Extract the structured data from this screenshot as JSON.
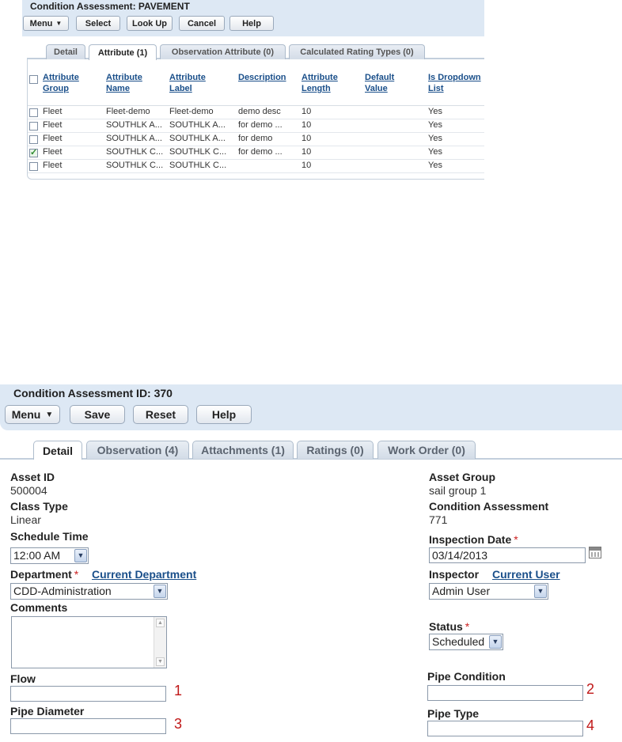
{
  "panel1": {
    "title": "Condition Assessment: PAVEMENT",
    "toolbar": {
      "menu": "Menu",
      "select": "Select",
      "lookup": "Look Up",
      "cancel": "Cancel",
      "help": "Help"
    },
    "tabs": [
      "Detail",
      "Attribute (1)",
      "Observation Attribute (0)",
      "Calculated Rating Types (0)"
    ],
    "active_tab": "Attribute (1)",
    "columns": {
      "group": [
        "Attribute",
        "Group"
      ],
      "name": [
        "Attribute",
        "Name"
      ],
      "label": [
        "Attribute",
        "Label"
      ],
      "description": [
        "Description",
        ""
      ],
      "length": [
        "Attribute",
        "Length"
      ],
      "default": [
        "Default",
        "Value"
      ],
      "dropdown": [
        "Is Dropdown",
        "List"
      ]
    },
    "rows": [
      {
        "checked": false,
        "group": "Fleet",
        "name": "Fleet-demo",
        "label": "Fleet-demo",
        "description": "demo desc",
        "length": "10",
        "default": "",
        "dropdown": "Yes"
      },
      {
        "checked": false,
        "group": "Fleet",
        "name": "SOUTHLK A...",
        "label": "SOUTHLK A...",
        "description": "for demo ...",
        "length": "10",
        "default": "",
        "dropdown": "Yes"
      },
      {
        "checked": false,
        "group": "Fleet",
        "name": "SOUTHLK A...",
        "label": "SOUTHLK A...",
        "description": "for demo",
        "length": "10",
        "default": "",
        "dropdown": "Yes"
      },
      {
        "checked": true,
        "group": "Fleet",
        "name": "SOUTHLK C...",
        "label": "SOUTHLK C...",
        "description": "for demo ...",
        "length": "10",
        "default": "",
        "dropdown": "Yes"
      },
      {
        "checked": false,
        "group": "Fleet",
        "name": "SOUTHLK C...",
        "label": "SOUTHLK C...",
        "description": "",
        "length": "10",
        "default": "",
        "dropdown": "Yes"
      }
    ]
  },
  "panel2": {
    "title": "Condition Assessment ID: 370",
    "toolbar": {
      "menu": "Menu",
      "save": "Save",
      "reset": "Reset",
      "help": "Help"
    },
    "tabs": [
      "Detail",
      "Observation (4)",
      "Attachments (1)",
      "Ratings (0)",
      "Work Order (0)"
    ],
    "active_tab": "Detail",
    "fields": {
      "asset_id": {
        "label": "Asset ID",
        "value": "500004"
      },
      "class_type": {
        "label": "Class Type",
        "value": "Linear"
      },
      "schedule_time": {
        "label": "Schedule Time",
        "value": "12:00 AM"
      },
      "department": {
        "label": "Department",
        "required": "*",
        "link": "Current Department",
        "value": "CDD-Administration"
      },
      "comments": {
        "label": "Comments",
        "value": ""
      },
      "flow": {
        "label": "Flow",
        "value": "",
        "marker": "1"
      },
      "pipe_diameter": {
        "label": "Pipe Diameter",
        "value": "",
        "marker": "3"
      },
      "asset_group": {
        "label": "Asset Group",
        "value": "sail group 1"
      },
      "condition_assessment": {
        "label": "Condition Assessment",
        "value": "771"
      },
      "inspection_date": {
        "label": "Inspection Date",
        "required": "*",
        "value": "03/14/2013"
      },
      "inspector": {
        "label": "Inspector",
        "link": "Current User",
        "value": "Admin User"
      },
      "status": {
        "label": "Status",
        "required": "*",
        "value": "Scheduled"
      },
      "pipe_condition": {
        "label": "Pipe Condition",
        "value": "",
        "marker": "2"
      },
      "pipe_type": {
        "label": "Pipe Type",
        "value": "",
        "marker": "4"
      }
    }
  },
  "icons": {
    "menu_dropdown": "caret-down-icon",
    "select_dropdown": "chevron-down-icon",
    "calendar": "calendar-icon"
  }
}
